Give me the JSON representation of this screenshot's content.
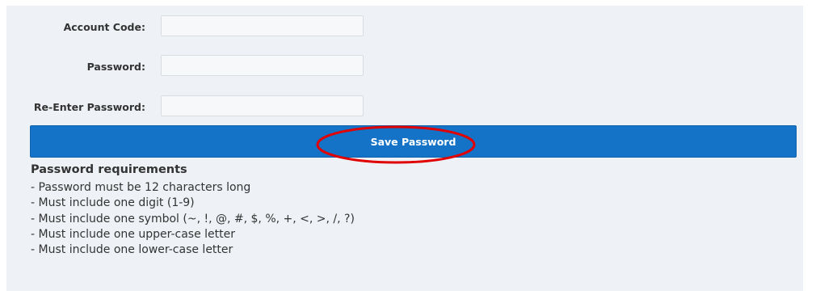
{
  "form": {
    "fields": [
      {
        "label": "Account Code:",
        "value": "",
        "placeholder": ""
      },
      {
        "label": "Password:",
        "value": "",
        "placeholder": ""
      },
      {
        "label": "Re-Enter Password:",
        "value": "",
        "placeholder": ""
      }
    ],
    "save_label": "Save Password"
  },
  "annotation": {
    "color": "#e00000"
  },
  "requirements": {
    "title": "Password requirements",
    "items": [
      "- Password must be 12 characters long",
      "- Must include one digit (1-9)",
      "- Must include one symbol (~, !, @, #, $, %, +, <, >, /, ?)",
      "- Must include one upper-case letter",
      "- Must include one lower-case letter"
    ]
  },
  "colors": {
    "panel_background": "#eef2f6",
    "button_background": "#1473c7",
    "button_text": "#ffffff"
  }
}
